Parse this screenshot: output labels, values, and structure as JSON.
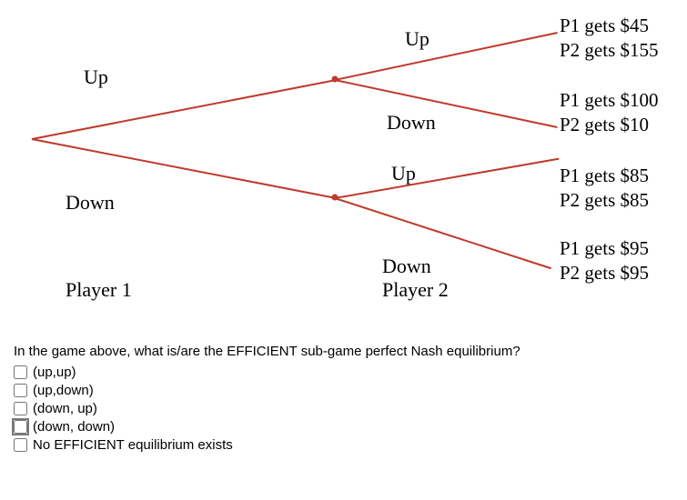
{
  "tree": {
    "p1_up_label": "Up",
    "p1_down_label": "Down",
    "p1_name": "Player 1",
    "p2_name": "Player 2",
    "p2_top_up_label": "Up",
    "p2_top_down_label": "Down",
    "p2_bot_up_label": "Up",
    "p2_bot_down_label": "Down",
    "payoffs": {
      "uu": {
        "p1": "P1 gets $45",
        "p2": "P2 gets $155"
      },
      "ud": {
        "p1": "P1 gets $100",
        "p2": "P2 gets $10"
      },
      "du": {
        "p1": "P1 gets $85",
        "p2": "P2 gets $85"
      },
      "dd": {
        "p1": "P1 gets $95",
        "p2": "P2 gets $95"
      }
    }
  },
  "question": {
    "text": "In the game above, what is/are the EFFICIENT sub-game perfect Nash equilibrium?",
    "options": [
      "(up,up)",
      "(up,down)",
      "(down, up)",
      "(down, down)",
      "No EFFICIENT equilibrium exists"
    ]
  },
  "chart_data": {
    "type": "table",
    "title": "Sequential game tree payoffs",
    "players": [
      "Player 1",
      "Player 2"
    ],
    "actions": {
      "Player 1": [
        "Up",
        "Down"
      ],
      "Player 2": [
        "Up",
        "Down"
      ]
    },
    "payoffs": [
      {
        "p1_action": "Up",
        "p2_action": "Up",
        "P1": 45,
        "P2": 155
      },
      {
        "p1_action": "Up",
        "p2_action": "Down",
        "P1": 100,
        "P2": 10
      },
      {
        "p1_action": "Down",
        "p2_action": "Up",
        "P1": 85,
        "P2": 85
      },
      {
        "p1_action": "Down",
        "p2_action": "Down",
        "P1": 95,
        "P2": 95
      }
    ]
  }
}
